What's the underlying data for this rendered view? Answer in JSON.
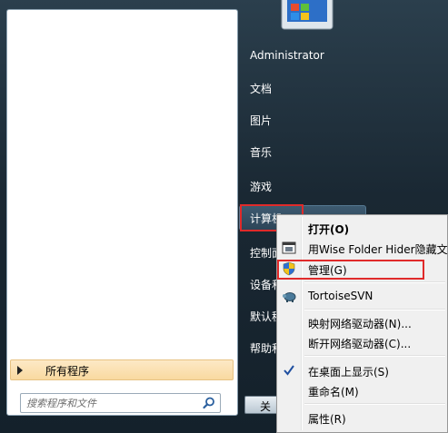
{
  "left_pane": {
    "all_programs": "所有程序",
    "search_placeholder": "搜索程序和文件"
  },
  "right_pane": {
    "items": [
      "Administrator",
      "文档",
      "图片",
      "音乐",
      "游戏",
      "计算机",
      "控制面",
      "设备和",
      "默认程",
      "帮助和"
    ],
    "shutdown_label": "关机"
  },
  "context_menu": {
    "items": [
      {
        "label": "打开(O)",
        "bold": true
      },
      {
        "label": "用Wise Folder Hider隐藏文",
        "icon": "wise-folder-hider-icon"
      },
      {
        "label": "管理(G)",
        "icon": "uac-shield-icon"
      },
      {
        "label": "TortoiseSVN",
        "icon": "tortoisesvn-icon"
      },
      {
        "label": "映射网络驱动器(N)..."
      },
      {
        "label": "断开网络驱动器(C)..."
      },
      {
        "label": "在桌面上显示(S)",
        "checked": true
      },
      {
        "label": "重命名(M)"
      },
      {
        "label": "属性(R)"
      }
    ]
  },
  "colors": {
    "highlight_border": "#e02a2a",
    "menu_bg": "#f0f0f0",
    "all_programs_bg": "#fde9c6"
  }
}
